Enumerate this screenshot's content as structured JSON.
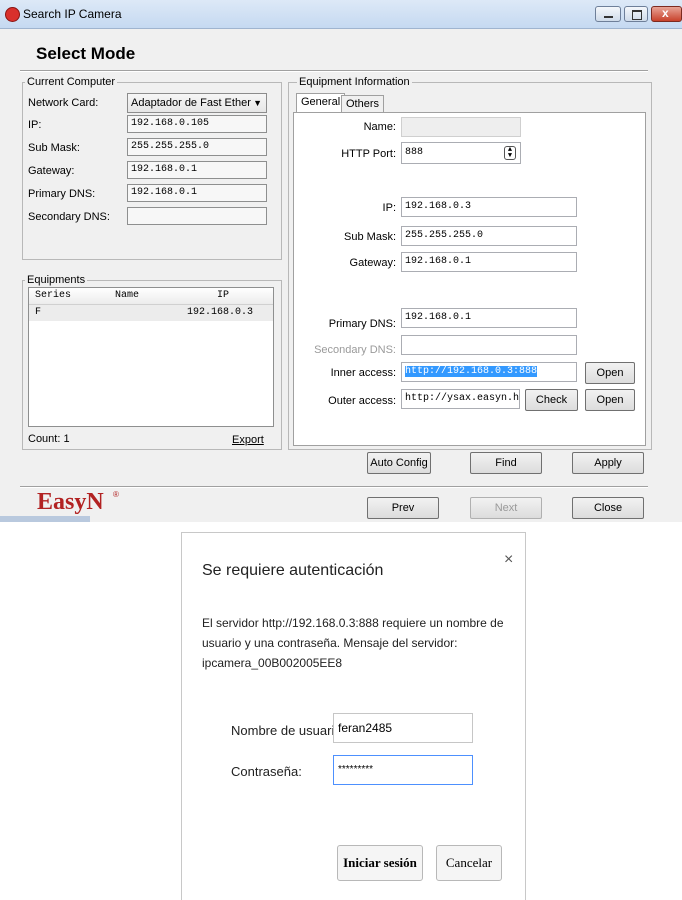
{
  "window": {
    "title": "Search IP Camera",
    "heading": "Select Mode"
  },
  "current_computer": {
    "legend": "Current Computer",
    "network_card_label": "Network Card:",
    "network_card_value": "Adaptador de Fast Ether",
    "ip_label": "IP:",
    "ip_value": "192.168.0.105",
    "sub_mask_label": "Sub Mask:",
    "sub_mask_value": "255.255.255.0",
    "gateway_label": "Gateway:",
    "gateway_value": "192.168.0.1",
    "primary_dns_label": "Primary DNS:",
    "primary_dns_value": "192.168.0.1",
    "secondary_dns_label": "Secondary DNS:",
    "secondary_dns_value": ""
  },
  "equipments": {
    "legend": "Equipments",
    "columns": [
      "Series",
      "Name",
      "IP"
    ],
    "rows": [
      {
        "series": "F",
        "name": "",
        "ip": "192.168.0.3"
      }
    ],
    "count_text": "Count: 1",
    "export_label": "Export"
  },
  "equipment_info": {
    "legend": "Equipment Information",
    "tabs": [
      "General",
      "Others"
    ],
    "name_label": "Name:",
    "name_value": "",
    "http_port_label": "HTTP Port:",
    "http_port_value": "888",
    "ip_label": "IP:",
    "ip_value": "192.168.0.3",
    "sub_mask_label": "Sub Mask:",
    "sub_mask_value": "255.255.255.0",
    "gateway_label": "Gateway:",
    "gateway_value": "192.168.0.1",
    "primary_dns_label": "Primary DNS:",
    "primary_dns_value": "192.168.0.1",
    "secondary_dns_label": "Secondary DNS:",
    "secondary_dns_value": "",
    "inner_access_label": "Inner access:",
    "inner_access_value": "http://192.168.0.3:888",
    "outer_access_label": "Outer access:",
    "outer_access_value": "http://ysax.easyn.hk",
    "open_label": "Open",
    "check_label": "Check"
  },
  "actions": {
    "auto_config": "Auto Config",
    "find": "Find",
    "apply": "Apply",
    "prev": "Prev",
    "next": "Next",
    "close": "Close"
  },
  "brand": {
    "logo_text": "EasyN",
    "logo_color": "#b22222"
  },
  "auth_dialog": {
    "title": "Se requiere autenticación",
    "message": "El servidor http://192.168.0.3:888 requiere un nombre de usuario y una contraseña. Mensaje del servidor: ipcamera_00B002005EE8",
    "username_label": "Nombre de usuario:",
    "username_value": "feran2485",
    "password_label": "Contraseña:",
    "password_value": "*********",
    "login_label": "Iniciar sesión",
    "cancel_label": "Cancelar",
    "close_glyph": "×"
  },
  "colors": {
    "selection": "#3399ff",
    "focus_border": "#4d90fe"
  }
}
